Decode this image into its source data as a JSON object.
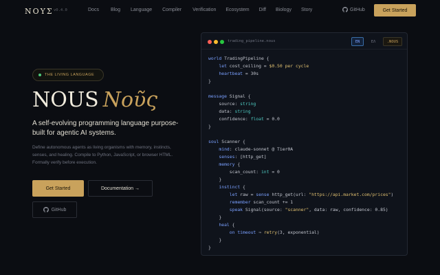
{
  "nav": {
    "logo": "NOYΣ",
    "version": "v0.4.0",
    "links": [
      "Docs",
      "Blog",
      "Language",
      "Compiler",
      "Verification",
      "Ecosystem",
      "Diff",
      "Biology",
      "Story"
    ],
    "github": "GitHub",
    "cta": "Get Started"
  },
  "hero": {
    "badge": "THE LIVING LANGUAGE",
    "title": "NOUS",
    "title_greek": "Νοῦς",
    "subtitle": "A self-evolving programming language purpose-built for agentic AI systems.",
    "description": "Define autonomous agents as living organisms with memory, instincts, senses, and healing. Compile to Python, JavaScript, or browser HTML. Formally verify before execution.",
    "primary_button": "Get Started",
    "secondary_button": "Documentation →",
    "github_button": "GitHub"
  },
  "editor": {
    "filename": "trading_pipeline.nous",
    "tabs": [
      "EN",
      "ΕΛ",
      ".NOUS"
    ],
    "active_tab": "EN",
    "dots": [
      "#ff5f57",
      "#febc2e",
      "#28c840"
    ],
    "code": {
      "l1": "world",
      "l1b": " TradingPipeline {",
      "l2a": "let",
      "l2b": " cost_ceiling = ",
      "l2c": "$0.50 per cycle",
      "l3a": "heartbeat",
      "l3b": " = 30s",
      "l4": "}",
      "l6a": "message",
      "l6b": " Signal {",
      "l7a": "source: ",
      "l7b": "string",
      "l8a": "data: ",
      "l8b": "string",
      "l9a": "confidence: ",
      "l9b": "float",
      "l9c": " = 0.0",
      "l10": "}",
      "l12a": "soul",
      "l12b": " Scanner {",
      "l13a": "mind",
      "l13b": ": claude-sonnet @ Tier0A",
      "l14a": "senses",
      "l14b": ": [http_get]",
      "l15a": "memory",
      "l15b": " {",
      "l16a": "scan_count: ",
      "l16b": "int",
      "l16c": " = 0",
      "l17": "}",
      "l18a": "instinct",
      "l18b": " {",
      "l19a": "let",
      "l19b": " raw = ",
      "l19c": "sense",
      "l19d": " http_get(url: ",
      "l19e": "\"https://api.market.com/prices\"",
      "l19f": ")",
      "l20a": "remember",
      "l20b": " scan_count += 1",
      "l21a": "speak",
      "l21b": " Signal(source: ",
      "l21c": "\"scanner\"",
      "l21d": ", data: raw, confidence: 0.85)",
      "l22": "}",
      "l23a": "heal",
      "l23b": " {",
      "l24a": "on",
      "l24b": " timeout",
      "l24c": " ⇒ ",
      "l24d": "retry",
      "l24e": "(3, exponential)",
      "l25": "}",
      "l26": "}"
    }
  },
  "colors": {
    "accent": "#c9a25c",
    "background": "#0b0d12",
    "live": "#4ec97a"
  }
}
